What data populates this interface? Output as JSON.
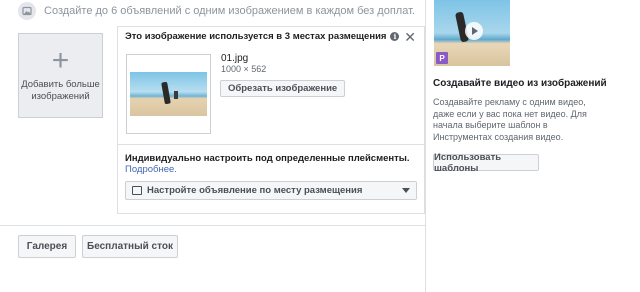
{
  "hint": {
    "text": "Создайте до 6 объявлений с одним изображением в каждом без доплат.",
    "icon": "image-icon"
  },
  "add_more": {
    "label": "Добавить больше изображений",
    "icon": "plus-icon"
  },
  "image_card": {
    "header": "Это изображение используется в 3 местах размещения",
    "info_icon": "info-icon",
    "close_icon": "close-icon",
    "file_name": "01.jpg",
    "file_dims": "1000 × 562",
    "crop_label": "Обрезать изображение",
    "customize_text": "Индивидуально настроить под определенные плейсменты.",
    "customize_link": "Подробнее.",
    "placement_select": "Настройте объявление по месту размещения",
    "placement_icon": "placement-icon",
    "caret_icon": "chevron-down-icon"
  },
  "buttons": {
    "gallery": "Галерея",
    "free_stock": "Бесплатный сток"
  },
  "side": {
    "badge": "P",
    "title": "Создавайте видео из изображений",
    "description": "Создавайте рекламу с одним видео, даже если у вас пока нет видео. Для начала выберите шаблон в Инструментах создания видео.",
    "templates_label": "Использовать шаблоны",
    "play_icon": "play-icon"
  },
  "colors": {
    "link": "#4267b2",
    "badge": "#8a5bc6",
    "border": "#dddfe2"
  }
}
